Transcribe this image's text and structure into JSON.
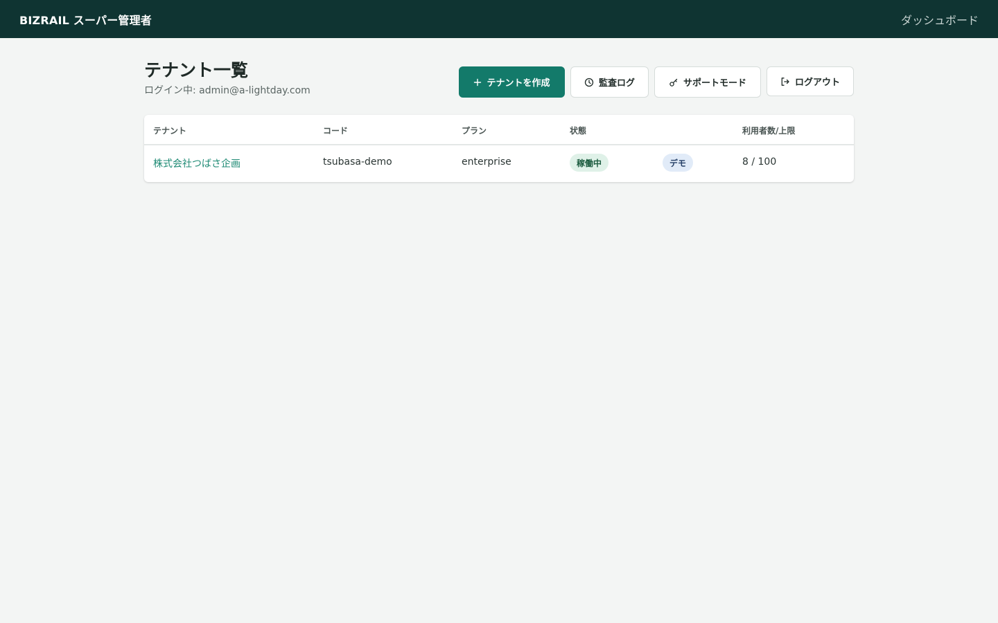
{
  "topbar": {
    "brand": "BIZRAIL スーパー管理者",
    "nav_dashboard": "ダッシュボード"
  },
  "page": {
    "title": "テナント一覧",
    "login_info": "ログイン中: admin@a-lightday.com"
  },
  "actions": {
    "create": {
      "label": "テナントを作成",
      "icon": "plus-icon"
    },
    "audit": {
      "label": "監査ログ",
      "icon": "clock-icon"
    },
    "support": {
      "label": "サポートモード",
      "icon": "key-icon"
    },
    "logout": {
      "label": "ログアウト",
      "icon": "logout-icon"
    }
  },
  "table": {
    "headers": {
      "tenant": "テナント",
      "code": "コード",
      "plan": "プラン",
      "status": "状態",
      "usage": "利用者数/上限"
    },
    "rows": [
      {
        "tenant": "株式会社つばさ企画",
        "code": "tsubasa-demo",
        "plan": "enterprise",
        "status": "稼働中",
        "tag": "デモ",
        "usage": "8 / 100"
      }
    ]
  },
  "colors": {
    "topbar": "#0f3432",
    "primary": "#137a6a",
    "link": "#1e8a74",
    "background": "#f3f5f4"
  }
}
